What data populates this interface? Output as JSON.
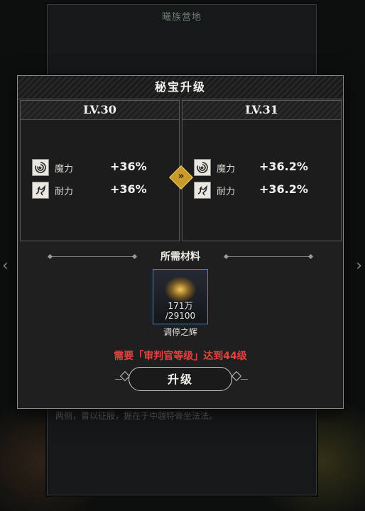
{
  "background": {
    "panel_title": "曦族营地",
    "caption": "两侧，曾以征服，据在于中越特骨坐法法。",
    "nav_prev": "‹",
    "nav_next": "›"
  },
  "dialog": {
    "title": "秘宝升级",
    "current": {
      "level": "LV.30",
      "stats": [
        {
          "icon": "magic-swirl-icon",
          "name": "魔力",
          "value": "+36%"
        },
        {
          "icon": "dragon-endurance-icon",
          "name": "耐力",
          "value": "+36%"
        }
      ]
    },
    "next": {
      "level": "LV.31",
      "stats": [
        {
          "icon": "magic-swirl-icon",
          "name": "魔力",
          "value": "+36.2%"
        },
        {
          "icon": "dragon-endurance-icon",
          "name": "耐力",
          "value": "+36.2%"
        }
      ]
    },
    "arrow_glyph": "»",
    "materials_title": "所需材料",
    "material": {
      "icon": "glowing-gem-icon",
      "owned": "171万",
      "required": "/29100",
      "name": "调停之辉"
    },
    "requirement_text": "需要「审判官等级」达到44级",
    "upgrade_button": "升级"
  }
}
